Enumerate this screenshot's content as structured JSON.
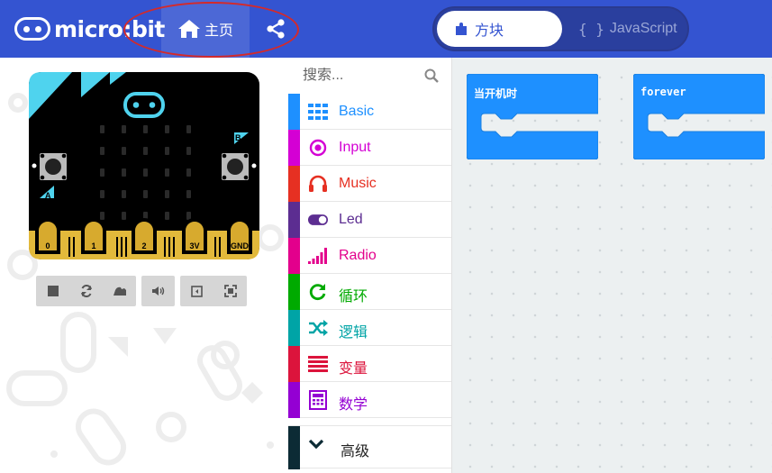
{
  "header": {
    "logo_text": "micro:bit",
    "home_label": "主页",
    "toggle": {
      "blocks_label": "方块",
      "js_label": "JavaScript",
      "js_braces": "{ }"
    },
    "icons": {
      "home": "home-icon",
      "share": "share-icon",
      "blocks": "puzzle-icon"
    },
    "colors": {
      "header_bg": "#3454D1",
      "annotation": "#d42a2a"
    }
  },
  "simulator": {
    "board": {
      "button_a": "A",
      "button_b": "B",
      "pins": [
        "0",
        "1",
        "2",
        "3V",
        "GND"
      ]
    },
    "controls": [
      "stop-icon",
      "restart-icon",
      "slowmo-icon",
      "mute-icon",
      "screenshot-icon",
      "fullscreen-icon"
    ]
  },
  "toolbox": {
    "search_placeholder": "搜索...",
    "categories": [
      {
        "label": "Basic",
        "color": "#1E90FF",
        "icon": "grid-icon"
      },
      {
        "label": "Input",
        "color": "#D400D4",
        "icon": "radio-button-icon"
      },
      {
        "label": "Music",
        "color": "#E63022",
        "icon": "headphones-icon"
      },
      {
        "label": "Led",
        "color": "#5C2D91",
        "icon": "toggle-icon"
      },
      {
        "label": "Radio",
        "color": "#E3008C",
        "icon": "signal-bars-icon"
      },
      {
        "label": "循环",
        "color": "#00AA00",
        "icon": "refresh-icon"
      },
      {
        "label": "逻辑",
        "color": "#00A4A6",
        "icon": "shuffle-icon"
      },
      {
        "label": "变量",
        "color": "#DC143C",
        "icon": "list-icon"
      },
      {
        "label": "数学",
        "color": "#9400D3",
        "icon": "calculator-icon"
      }
    ],
    "advanced_label": "高级",
    "advanced_color": "#0c2b35"
  },
  "workspace": {
    "blocks": [
      {
        "label": "当开机时",
        "color": "#1E90FF"
      },
      {
        "label": "forever",
        "color": "#1E90FF"
      }
    ]
  }
}
